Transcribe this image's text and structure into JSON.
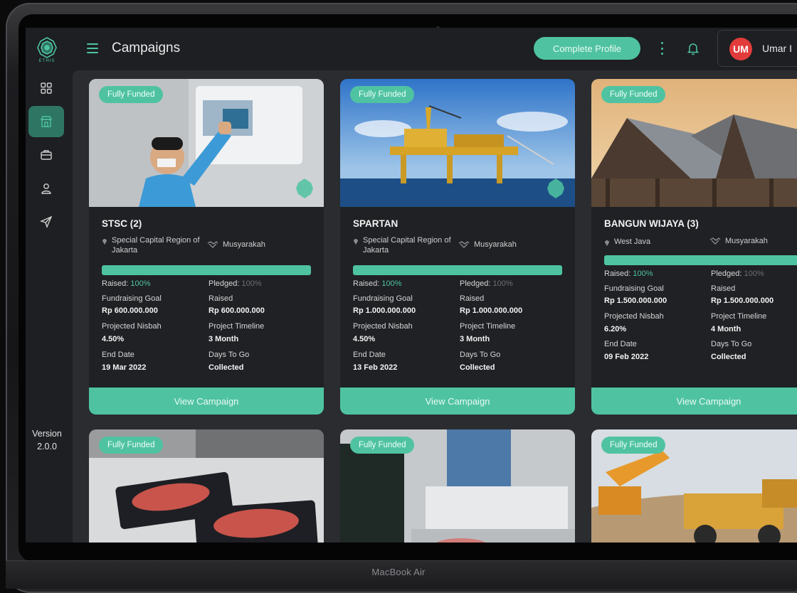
{
  "device": {
    "label": "MacBook Air"
  },
  "app": {
    "logo_text": "ETHIS",
    "version_label": "Version",
    "version_number": "2.0.0",
    "colors": {
      "accent": "#4fc3a1",
      "avatar": "#e23b3b",
      "background": "#1d1f22"
    }
  },
  "sidebar": {
    "items": [
      {
        "name": "dashboard",
        "icon": "grid-icon"
      },
      {
        "name": "campaigns",
        "icon": "store-icon",
        "active": true
      },
      {
        "name": "portfolio",
        "icon": "briefcase-icon"
      },
      {
        "name": "profile",
        "icon": "user-icon"
      },
      {
        "name": "send",
        "icon": "send-icon"
      }
    ]
  },
  "header": {
    "title": "Campaigns",
    "complete_profile_label": "Complete Profile",
    "avatar_initials": "UM",
    "user_name": "Umar I"
  },
  "labels": {
    "raised_prefix": "Raised:",
    "pledged_prefix": "Pledged:",
    "fundraising_goal": "Fundraising Goal",
    "raised": "Raised",
    "projected_nisbah": "Projected Nisbah",
    "project_timeline": "Project Timeline",
    "end_date": "End Date",
    "days_to_go": "Days To Go",
    "view_campaign": "View Campaign",
    "badge": "Fully Funded"
  },
  "campaigns": [
    {
      "title": "STSC (2)",
      "location": "Special Capital Region of Jakarta",
      "scheme": "Musyarakah",
      "raised_pct": "100%",
      "pledged_pct": "100%",
      "goal": "Rp 600.000.000",
      "raised": "Rp 600.000.000",
      "nisbah": "4.50%",
      "timeline": "3 Month",
      "end_date": "19 Mar 2022",
      "days_to_go": "Collected"
    },
    {
      "title": "SPARTAN",
      "location": "Special Capital Region of Jakarta",
      "scheme": "Musyarakah",
      "raised_pct": "100%",
      "pledged_pct": "100%",
      "goal": "Rp 1.000.000.000",
      "raised": "Rp 1.000.000.000",
      "nisbah": "4.50%",
      "timeline": "3 Month",
      "end_date": "13 Feb 2022",
      "days_to_go": "Collected"
    },
    {
      "title": "BANGUN WIJAYA (3)",
      "location": "West Java",
      "scheme": "Musyarakah",
      "raised_pct": "100%",
      "pledged_pct": "100%",
      "goal": "Rp 1.500.000.000",
      "raised": "Rp 1.500.000.000",
      "nisbah": "6.20%",
      "timeline": "4 Month",
      "end_date": "09 Feb 2022",
      "days_to_go": "Collected"
    }
  ]
}
